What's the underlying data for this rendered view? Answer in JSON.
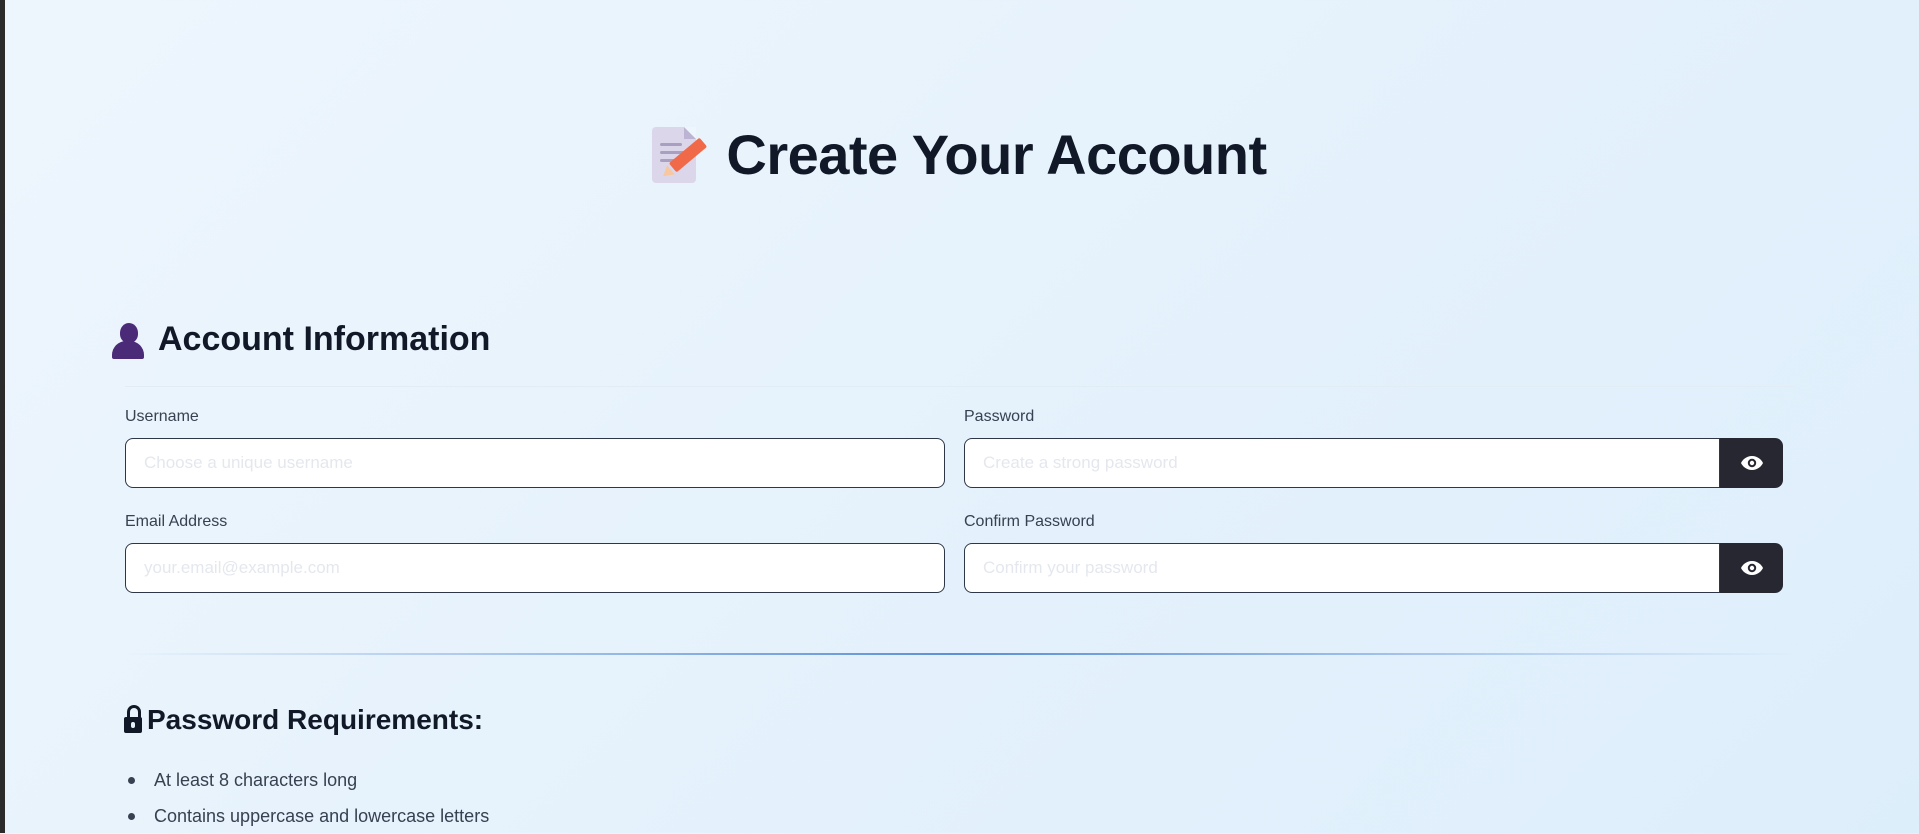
{
  "page": {
    "title": "Create Your Account",
    "title_icon": "memo-icon"
  },
  "account_section": {
    "title": "Account Information",
    "icon": "person-silhouette-icon",
    "fields": {
      "username": {
        "label": "Username",
        "placeholder": "Choose a unique username",
        "value": ""
      },
      "password": {
        "label": "Password",
        "placeholder": "Create a strong password",
        "value": "",
        "toggle_icon": "eye-icon"
      },
      "email": {
        "label": "Email Address",
        "placeholder": "your.email@example.com",
        "value": ""
      },
      "confirm_password": {
        "label": "Confirm Password",
        "placeholder": "Confirm your password",
        "value": "",
        "toggle_icon": "eye-icon"
      }
    }
  },
  "requirements": {
    "icon": "lock-icon",
    "title": "Password Requirements:",
    "items": [
      "At least 8 characters long",
      "Contains uppercase and lowercase letters"
    ]
  },
  "colors": {
    "background": "#e6f2fc",
    "text": "#111827",
    "toggle_button": "#262730",
    "divider_accent": "#5c8fd6",
    "person_icon": "#4b2a78"
  }
}
